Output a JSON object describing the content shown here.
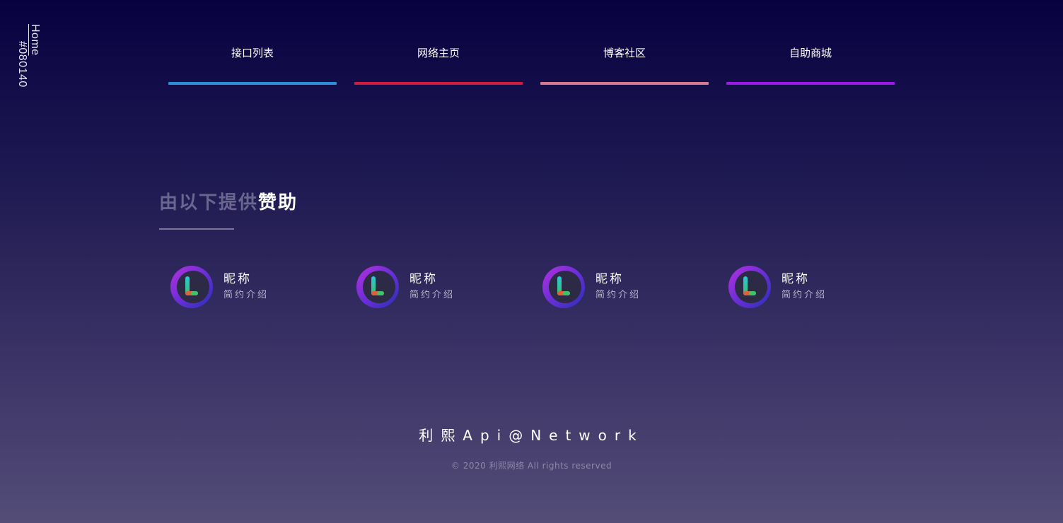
{
  "side": {
    "home_label": "Home",
    "color_code": "#080140"
  },
  "nav": {
    "items": [
      {
        "label": "接口列表",
        "color": "#2d8fd8"
      },
      {
        "label": "网络主页",
        "color": "#d01c3c"
      },
      {
        "label": "博客社区",
        "color": "#d6798f"
      },
      {
        "label": "自助商城",
        "color": "#9b17e6"
      }
    ]
  },
  "sponsor": {
    "title_muted": "由以下提供",
    "title_strong": "赞助",
    "cards": [
      {
        "nickname": "昵称",
        "intro": "简约介绍",
        "logo_icon": "L-logo-icon"
      },
      {
        "nickname": "昵称",
        "intro": "简约介绍",
        "logo_icon": "L-logo-icon"
      },
      {
        "nickname": "昵称",
        "intro": "简约介绍",
        "logo_icon": "L-logo-icon"
      },
      {
        "nickname": "昵称",
        "intro": "简约介绍",
        "logo_icon": "L-logo-icon"
      }
    ]
  },
  "footer": {
    "brand": "利熙Api@Network",
    "copyright": "© 2020 利熙网络 All rights reserved"
  },
  "colors": {
    "background_top": "#080140",
    "background_bottom": "#534d78"
  }
}
